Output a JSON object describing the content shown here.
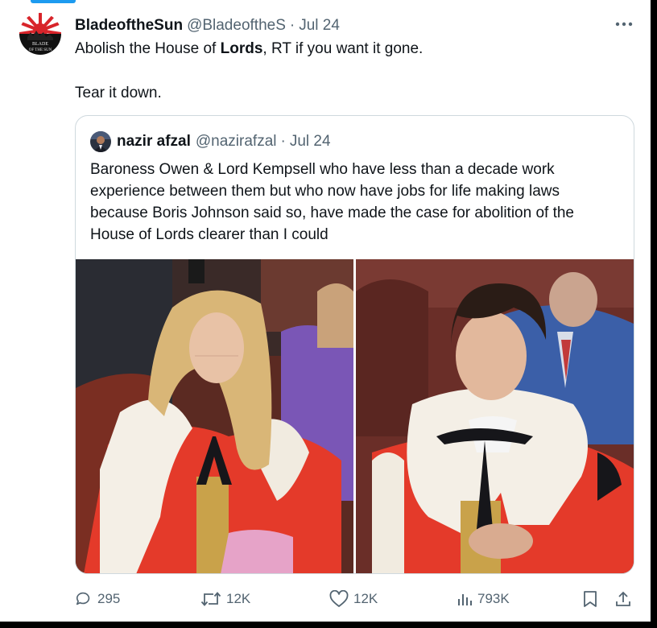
{
  "tweet": {
    "display_name": "BladeoftheSun",
    "handle": "@BladeoftheS",
    "separator": "·",
    "date": "Jul 24",
    "text_line1_before": "Abolish the House of ",
    "text_line1_bold": "Lords",
    "text_line1_after": ", RT if you want it gone.",
    "text_line2": "Tear it down.",
    "avatar_caption": "BLADE OF THE SUN"
  },
  "quote": {
    "display_name": "nazir afzal",
    "handle": "@nazirafzal",
    "separator": "·",
    "date": "Jul 24",
    "lines": [
      "Baroness Owen & Lord Kempsell who have less than a decade work",
      "experience between them but who now have jobs for life making laws",
      "because Boris Johnson said so, have made the case for abolition of the",
      "House of Lords clearer than I could"
    ]
  },
  "actions": {
    "replies": "295",
    "reposts": "12K",
    "likes": "12K",
    "views": "793K"
  },
  "icons": {
    "more": "more-icon",
    "reply": "reply-icon",
    "repost": "repost-icon",
    "like": "like-icon",
    "views": "views-icon",
    "bookmark": "bookmark-icon",
    "share": "share-icon"
  },
  "colors": {
    "accent": "#1d9bf0",
    "text_primary": "#0f1419",
    "text_secondary": "#536471",
    "border": "#cfd9de",
    "robe_red": "#e43a2a"
  }
}
